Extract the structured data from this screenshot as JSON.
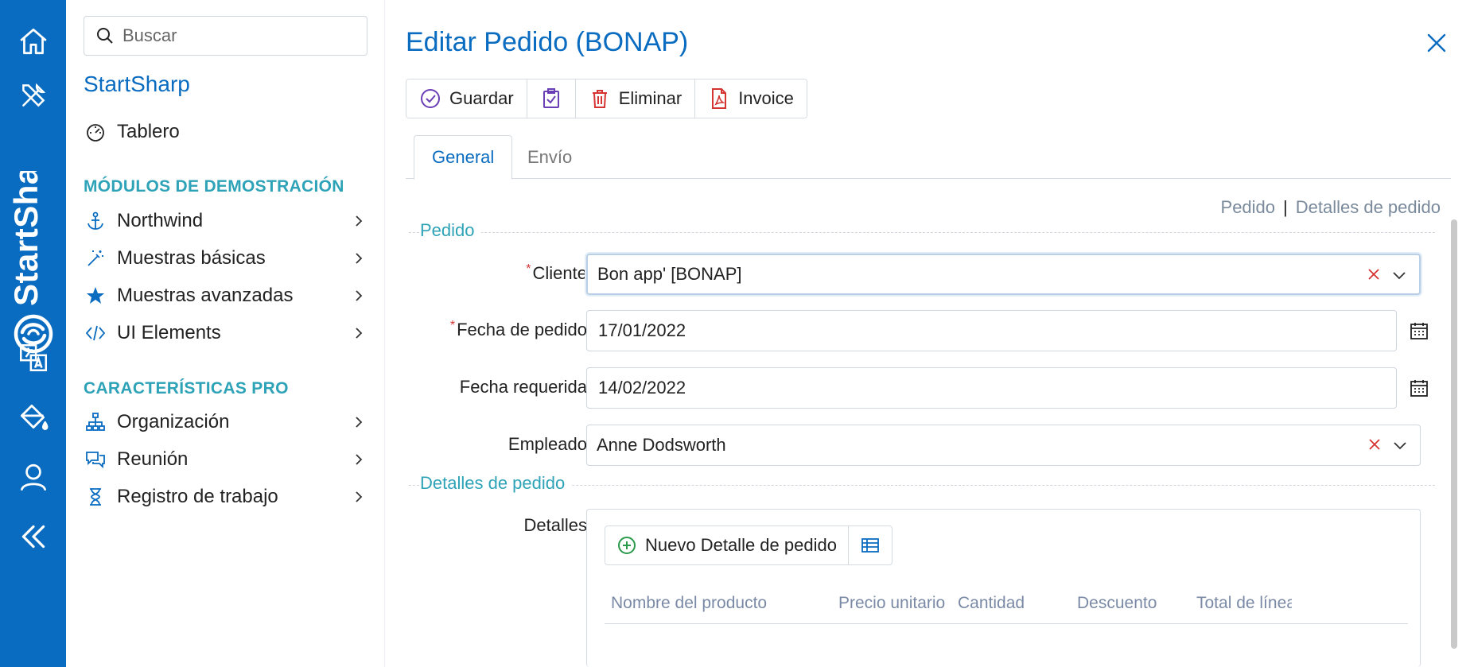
{
  "rail": {
    "brand": "StartShar",
    "items": [
      {
        "icon": "home-icon"
      },
      {
        "icon": "tools-icon"
      },
      {
        "icon": "translate-icon"
      },
      {
        "icon": "paint-bucket-icon"
      },
      {
        "icon": "user-icon"
      },
      {
        "icon": "collapse-icon"
      }
    ]
  },
  "sidebar": {
    "search_placeholder": "Buscar",
    "title": "StartSharp",
    "dashboard": "Tablero",
    "section_demo": "MÓDULOS DE DEMOSTRACIÓN",
    "demo_items": [
      {
        "label": "Northwind",
        "icon": "anchor-icon"
      },
      {
        "label": "Muestras básicas",
        "icon": "magic-wand-icon"
      },
      {
        "label": "Muestras avanzadas",
        "icon": "star-icon"
      },
      {
        "label": "UI Elements",
        "icon": "code-icon"
      }
    ],
    "section_pro": "CARACTERÍSTICAS PRO",
    "pro_items": [
      {
        "label": "Organización",
        "icon": "org-chart-icon"
      },
      {
        "label": "Reunión",
        "icon": "chat-icon"
      },
      {
        "label": "Registro de trabajo",
        "icon": "hourglass-icon"
      }
    ]
  },
  "dialog": {
    "title": "Editar Pedido (BONAP)",
    "toolbar": {
      "save": "Guardar",
      "delete": "Eliminar",
      "invoice": "Invoice"
    },
    "tabs": [
      "General",
      "Envío"
    ],
    "nav_links": [
      "Pedido",
      "Detalles de pedido"
    ],
    "category_order": "Pedido",
    "category_details": "Detalles de pedido",
    "fields": {
      "customer_label": "Cliente",
      "customer_value": "Bon app' [BONAP]",
      "order_date_label": "Fecha de pedido",
      "order_date_value": "17/01/2022",
      "required_date_label": "Fecha requerida",
      "required_date_value": "14/02/2022",
      "employee_label": "Empleado",
      "employee_value": "Anne Dodsworth",
      "details_label": "Detalles"
    },
    "details_grid": {
      "new_button": "Nuevo Detalle de pedido",
      "columns": [
        "Nombre del producto",
        "Precio unitario",
        "Cantidad",
        "Descuento",
        "Total de línea"
      ]
    }
  },
  "colors": {
    "rail": "#0a6cc0",
    "accent": "#0a6cc0",
    "section": "#2ea3b8",
    "required": "#d63333"
  }
}
